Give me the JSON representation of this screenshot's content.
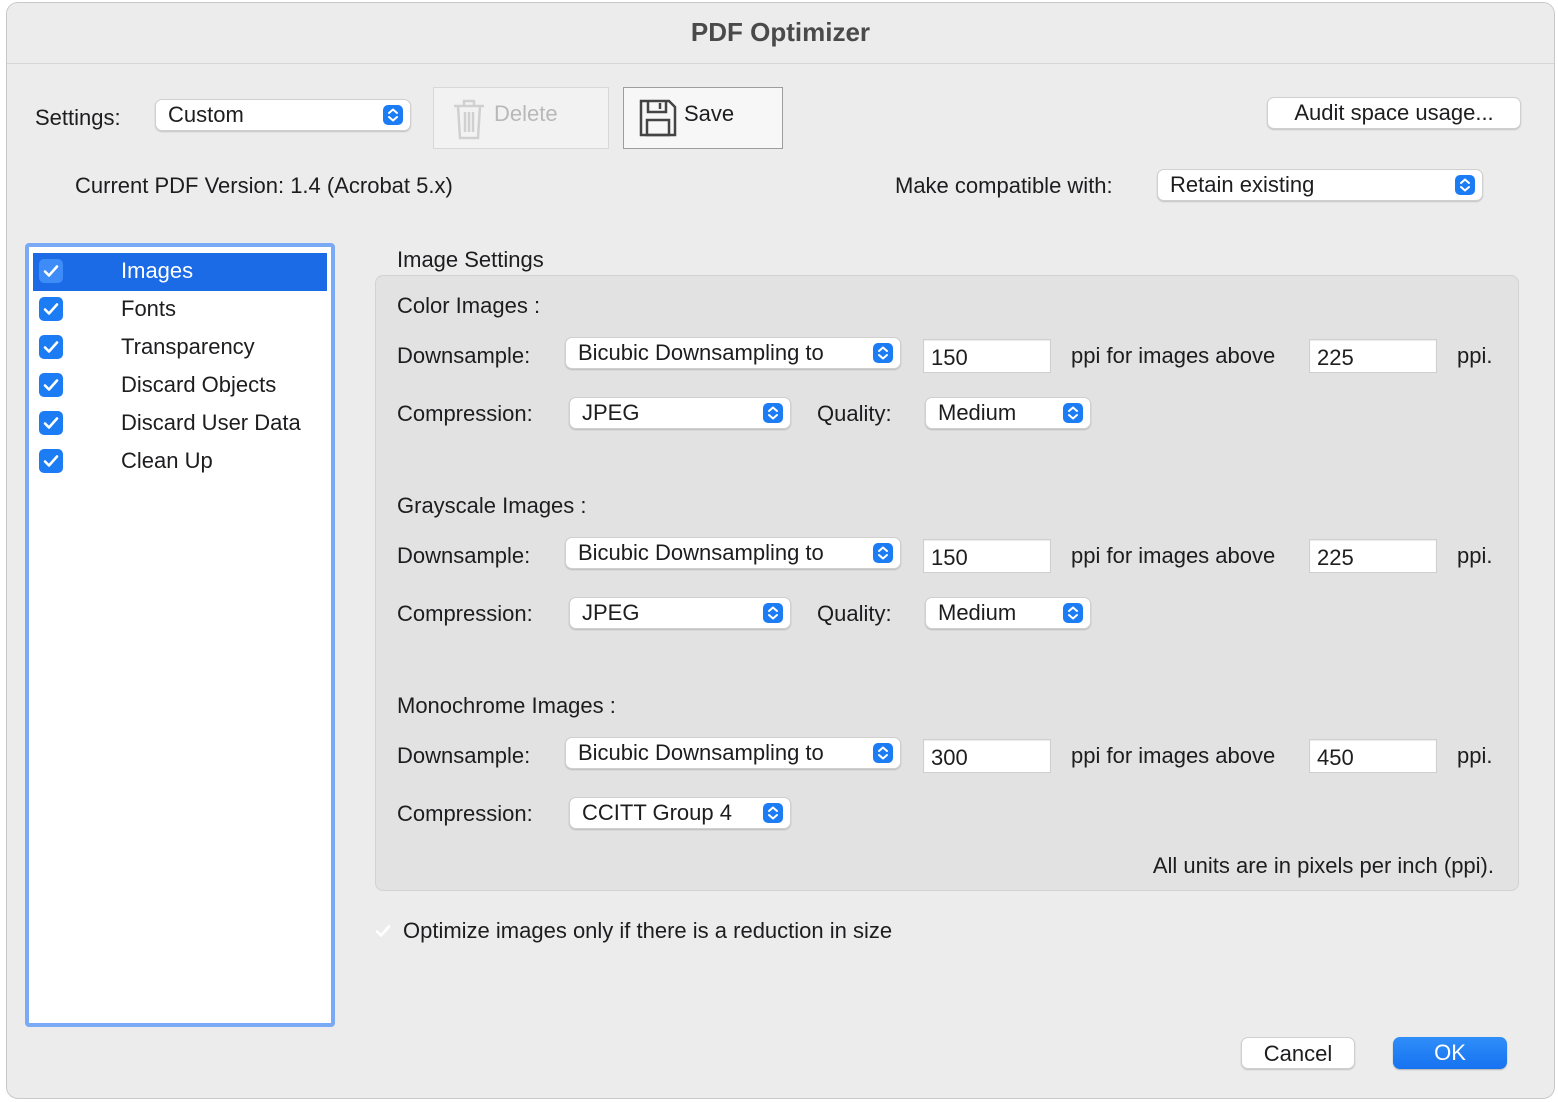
{
  "window": {
    "title": "PDF Optimizer"
  },
  "toolbar": {
    "settings_label": "Settings:",
    "settings_value": "Custom",
    "delete_label": "Delete",
    "save_label": "Save",
    "audit_label": "Audit space usage..."
  },
  "version": {
    "current": "Current PDF Version: 1.4 (Acrobat 5.x)",
    "compat_label": "Make compatible with:",
    "compat_value": "Retain existing"
  },
  "sidebar": {
    "items": [
      {
        "label": "Images",
        "checked": true,
        "selected": true
      },
      {
        "label": "Fonts",
        "checked": true,
        "selected": false
      },
      {
        "label": "Transparency",
        "checked": true,
        "selected": false
      },
      {
        "label": "Discard Objects",
        "checked": true,
        "selected": false
      },
      {
        "label": "Discard User Data",
        "checked": true,
        "selected": false
      },
      {
        "label": "Clean Up",
        "checked": true,
        "selected": false
      }
    ]
  },
  "panel": {
    "title": "Image Settings",
    "downsample_label": "Downsample:",
    "compression_label": "Compression:",
    "quality_label": "Quality:",
    "ppi_above_label": "ppi for images above",
    "ppi_unit": "ppi.",
    "color": {
      "header": "Color Images :",
      "downsample": "Bicubic Downsampling to",
      "ppi": "150",
      "above": "225",
      "compression": "JPEG",
      "quality": "Medium"
    },
    "grayscale": {
      "header": "Grayscale Images :",
      "downsample": "Bicubic Downsampling to",
      "ppi": "150",
      "above": "225",
      "compression": "JPEG",
      "quality": "Medium"
    },
    "monochrome": {
      "header": "Monochrome Images :",
      "downsample": "Bicubic Downsampling to",
      "ppi": "300",
      "above": "450",
      "compression": "CCITT Group 4"
    },
    "units_note": "All units are in pixels per inch (ppi)."
  },
  "optimize_only": {
    "label": "Optimize images only if there is a reduction in size",
    "checked": true
  },
  "footer": {
    "cancel_label": "Cancel",
    "ok_label": "OK"
  },
  "colors": {
    "accent": "#1c7cf4",
    "selection": "#1b6ae6",
    "focus_ring": "#7aaaf5"
  }
}
